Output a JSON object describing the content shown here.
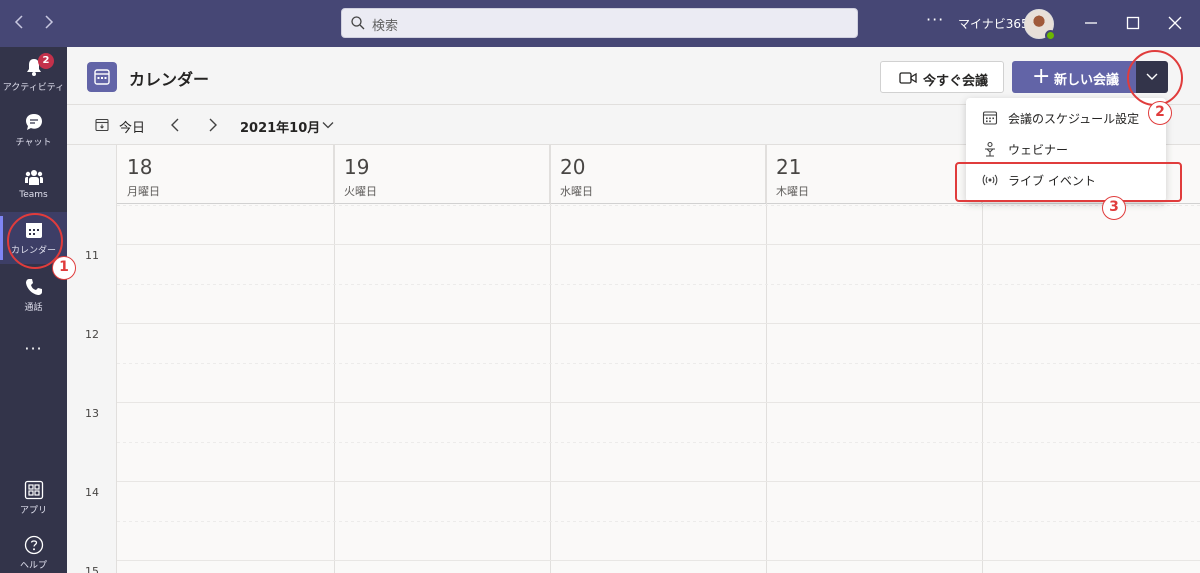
{
  "titlebar": {
    "back_icon": "chevron-left-icon",
    "forward_icon": "chevron-right-icon",
    "search_placeholder": "検索",
    "more": "···",
    "user_name": "マイナビ365",
    "presence_color": "#6bb700",
    "minimize": "—",
    "maximize": "☐",
    "close": "✕"
  },
  "rail": {
    "items": [
      {
        "label": "アクティビティ",
        "icon": "bell-icon",
        "badge": "2"
      },
      {
        "label": "チャット",
        "icon": "chat-icon"
      },
      {
        "label": "Teams",
        "icon": "teams-icon"
      },
      {
        "label": "カレンダー",
        "icon": "calendar-icon",
        "active": true
      },
      {
        "label": "通話",
        "icon": "phone-icon"
      }
    ],
    "more": "···",
    "apps_label": "アプリ",
    "help_label": "ヘルプ"
  },
  "header": {
    "title": "カレンダー",
    "meet_now_label": "今すぐ会議",
    "new_meeting_label": "新しい会議",
    "accent_color": "#6264a7"
  },
  "toolbar": {
    "today_label": "今日",
    "month_label": "2021年10月"
  },
  "calendar": {
    "days": [
      {
        "num": "18",
        "name": "月曜日"
      },
      {
        "num": "19",
        "name": "火曜日"
      },
      {
        "num": "20",
        "name": "水曜日"
      },
      {
        "num": "21",
        "name": "木曜日"
      },
      {
        "num": "",
        "name": ""
      }
    ],
    "hours": [
      "11",
      "12",
      "13",
      "14",
      "15"
    ]
  },
  "menu": {
    "items": [
      {
        "label": "会議のスケジュール設定",
        "icon": "calendar-icon"
      },
      {
        "label": "ウェビナー",
        "icon": "webinar-icon"
      },
      {
        "label": "ライブ イベント",
        "icon": "live-event-icon"
      }
    ]
  },
  "annotations": {
    "step1": "1",
    "step2": "2",
    "step3": "3",
    "color": "#e03c3c"
  }
}
